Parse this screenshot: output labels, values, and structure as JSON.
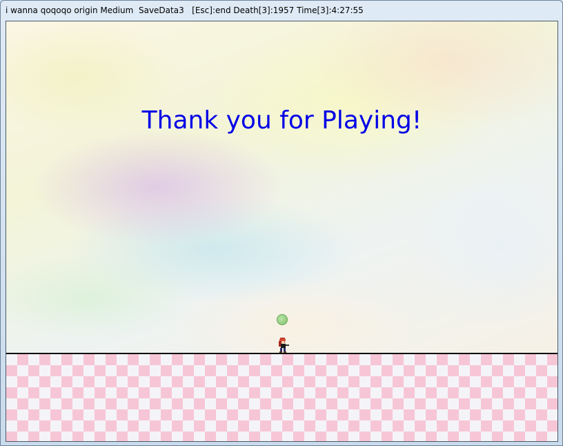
{
  "window": {
    "title": "i wanna qoqoqo origin Medium  SaveData3   [Esc]:end Death[3]:1957 Time[3]:4:27:55"
  },
  "game": {
    "message": "Thank you for Playing!",
    "colors": {
      "message": "#0000e6",
      "floor_pink": "#f7c6d6",
      "floor_white": "#f4f4f8",
      "ground_line": "#000000",
      "orb": "#8fd07a"
    },
    "sprites": {
      "orb": "green-save-orb-icon",
      "player": "kid-player-icon"
    }
  }
}
